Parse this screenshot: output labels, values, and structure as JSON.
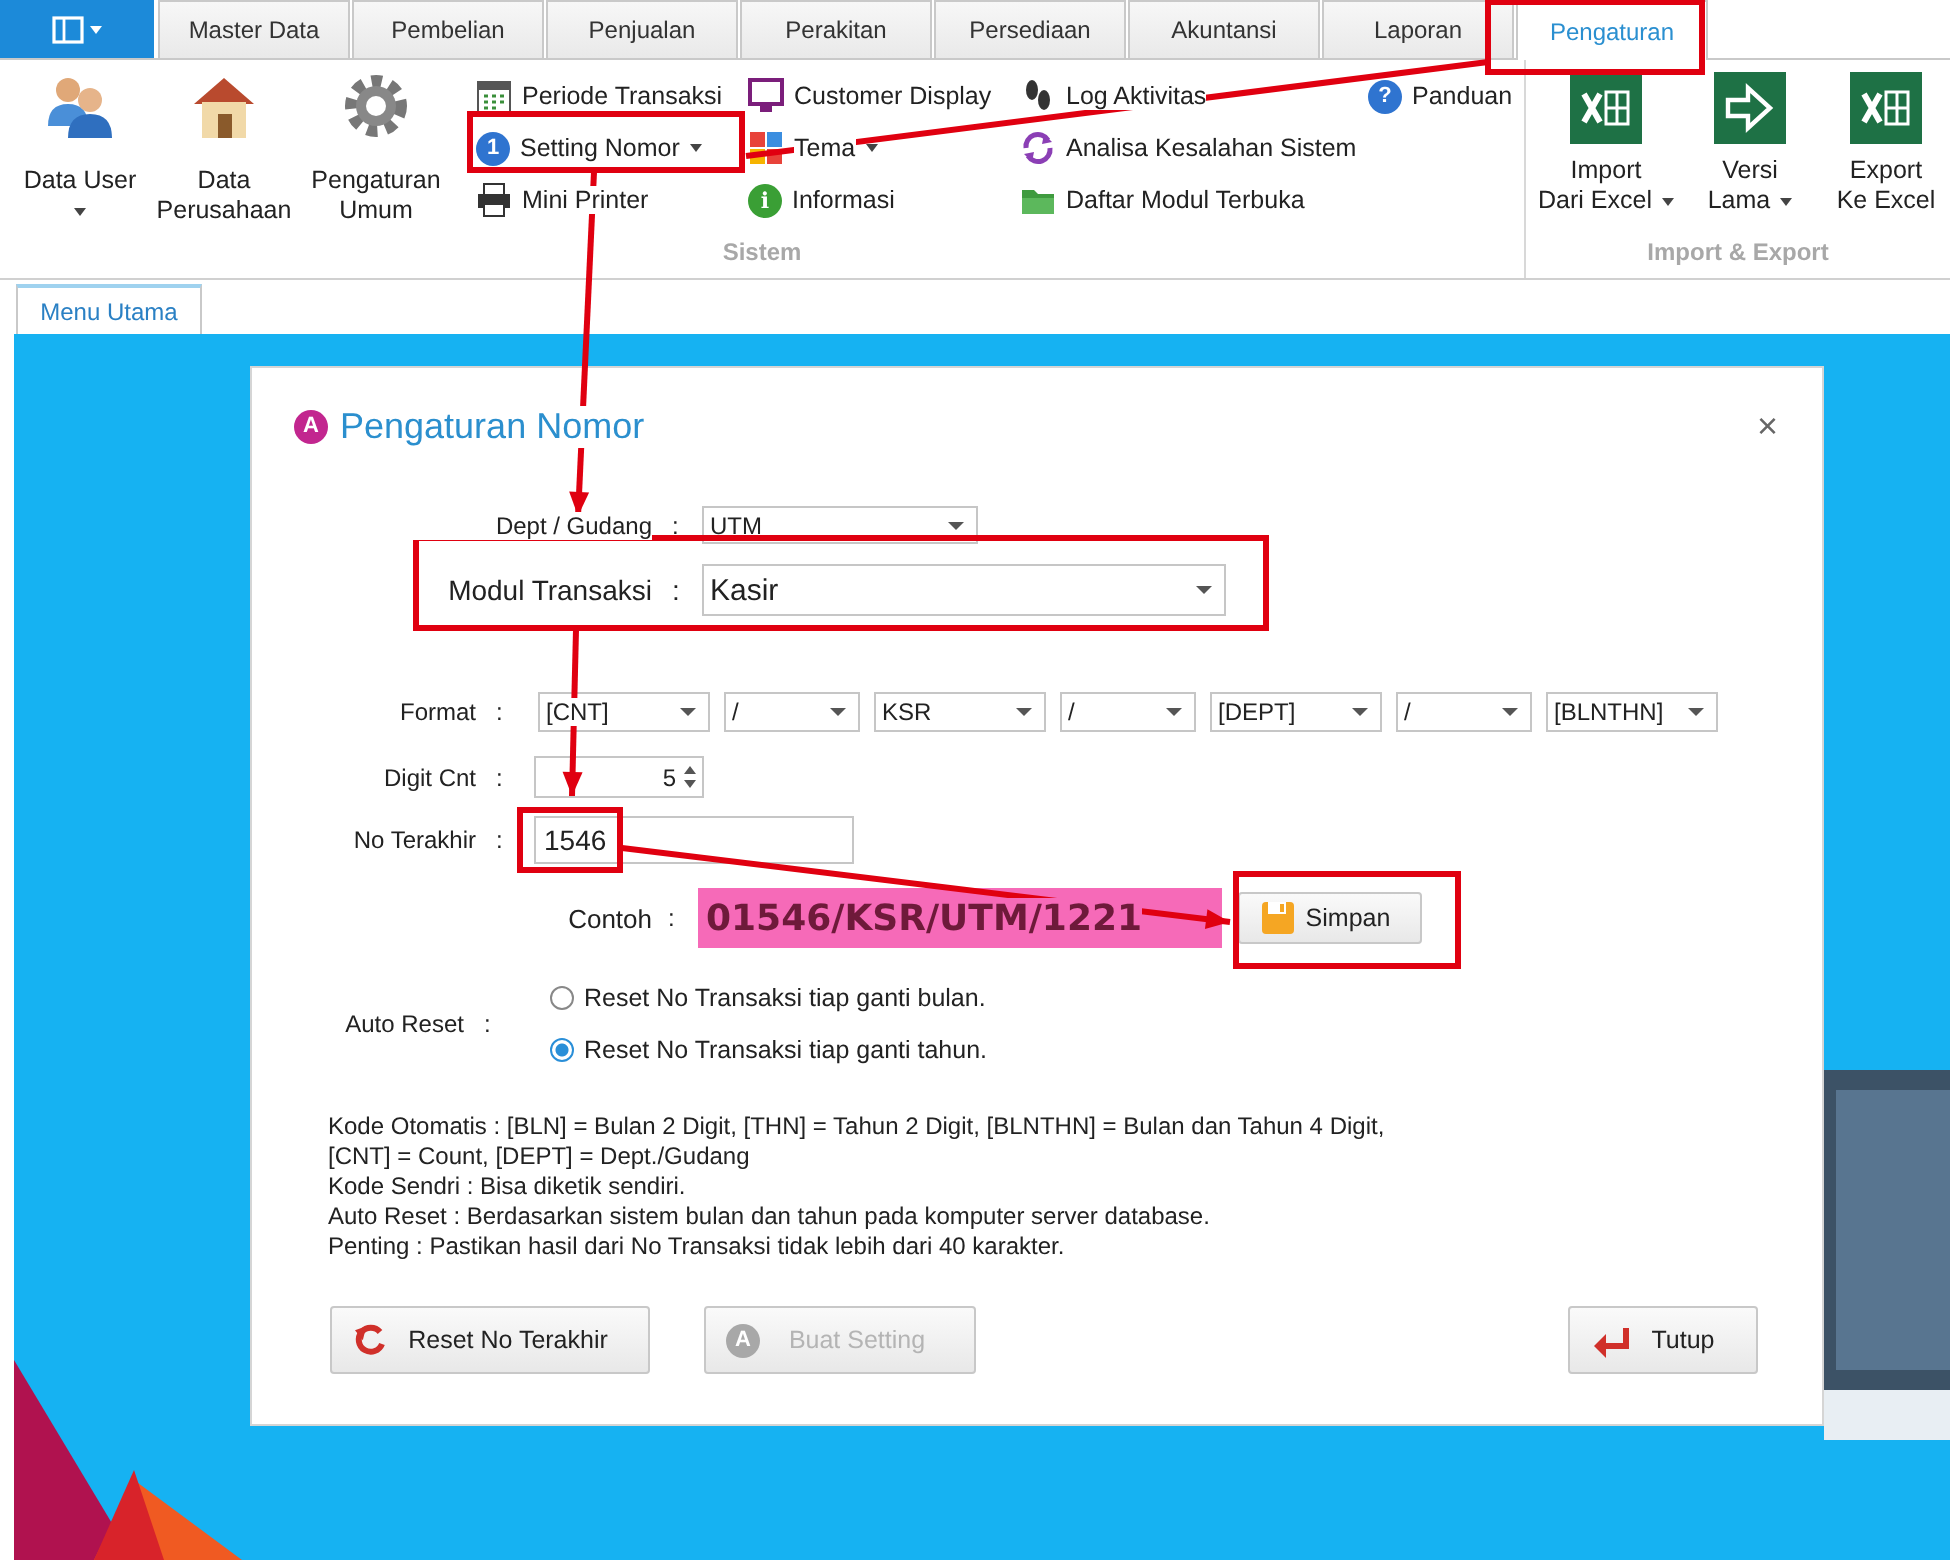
{
  "tabs": [
    {
      "label": "Master Data",
      "selected": false
    },
    {
      "label": "Pembelian",
      "selected": false
    },
    {
      "label": "Penjualan",
      "selected": false
    },
    {
      "label": "Perakitan",
      "selected": false
    },
    {
      "label": "Persediaan",
      "selected": false
    },
    {
      "label": "Akuntansi",
      "selected": false
    },
    {
      "label": "Laporan",
      "selected": false
    },
    {
      "label": "Pengaturan",
      "selected": true
    }
  ],
  "ribbon": {
    "groups": [
      {
        "label": "Sistem",
        "large_buttons": [
          {
            "lines": [
              "Data User"
            ],
            "dropdown": true,
            "kind": "users"
          },
          {
            "lines": [
              "Data",
              "Perusahaan"
            ],
            "dropdown": false,
            "kind": "house"
          },
          {
            "lines": [
              "Pengaturan",
              "Umum"
            ],
            "dropdown": false,
            "kind": "gear"
          }
        ],
        "columns": [
          [
            {
              "label": "Periode Transaksi",
              "kind": "calendar",
              "dropdown": false
            },
            {
              "label": "Setting Nomor",
              "kind": "badge",
              "badge": "1",
              "dropdown": true
            },
            {
              "label": "Mini Printer",
              "kind": "printer",
              "dropdown": false
            }
          ],
          [
            {
              "label": "Customer Display",
              "kind": "monitor",
              "dropdown": false
            },
            {
              "label": "Tema",
              "kind": "tiles",
              "dropdown": true
            },
            {
              "label": "Informasi",
              "kind": "info",
              "badge": "i",
              "dropdown": false
            }
          ],
          [
            {
              "label": "Log Aktivitas",
              "kind": "footprints",
              "dropdown": false
            },
            {
              "label": "Analisa Kesalahan Sistem",
              "kind": "cycle",
              "dropdown": false
            },
            {
              "label": "Daftar Modul Terbuka",
              "kind": "folder",
              "dropdown": false
            }
          ],
          [
            {
              "label": "Panduan",
              "kind": "help",
              "badge": "?",
              "dropdown": false
            }
          ]
        ]
      },
      {
        "label": "Import & Export",
        "large_buttons": [
          {
            "lines": [
              "Import",
              "Dari Excel"
            ],
            "dropdown": true,
            "kind": "excel"
          },
          {
            "lines": [
              "Versi",
              "Lama"
            ],
            "dropdown": true,
            "kind": "enter"
          },
          {
            "lines": [
              "Export",
              "Ke Excel"
            ],
            "dropdown": false,
            "kind": "excel"
          }
        ]
      }
    ]
  },
  "document_tabs": [
    {
      "label": "Menu Utama",
      "selected": true
    }
  ],
  "dialog": {
    "badge": "A",
    "title": "Pengaturan Nomor",
    "close": "×",
    "dept": {
      "label": "Dept / Gudang",
      "colon": ":",
      "value": "UTM"
    },
    "module": {
      "label": "Modul Transaksi",
      "colon": ":",
      "value": "Kasir"
    },
    "format": {
      "label": "Format",
      "colon": ":",
      "parts": [
        "[CNT]",
        "/",
        "KSR",
        "/",
        "[DEPT]",
        "/",
        "[BLNTHN]"
      ]
    },
    "digit_cnt": {
      "label": "Digit Cnt",
      "colon": ":",
      "value": "5"
    },
    "last_number": {
      "label": "No Terakhir",
      "colon": ":",
      "value": "1546"
    },
    "example": {
      "label": "Contoh",
      "colon": ":",
      "value": "01546/KSR/UTM/1221"
    },
    "save_button": "Simpan",
    "auto_reset": {
      "label": "Auto Reset",
      "colon": ":",
      "options": [
        {
          "label": "Reset No Transaksi tiap ganti bulan.",
          "selected": false
        },
        {
          "label": "Reset No Transaksi tiap ganti tahun.",
          "selected": true
        }
      ]
    },
    "notes": [
      "Kode Otomatis : [BLN] = Bulan 2 Digit, [THN] = Tahun 2 Digit, [BLNTHN] = Bulan dan Tahun 4 Digit,",
      "[CNT] = Count, [DEPT] = Dept./Gudang",
      "Kode Sendri : Bisa diketik sendiri.",
      "Auto Reset : Berdasarkan sistem bulan dan tahun pada komputer server database.",
      "Penting : Pastikan hasil dari No Transaksi tidak lebih dari 40 karakter."
    ],
    "buttons": [
      {
        "label": "Reset No Terakhir",
        "kind": "reset",
        "disabled": false
      },
      {
        "label": "Buat Setting",
        "kind": "badge",
        "badge": "A",
        "disabled": true
      },
      {
        "label": "Tutup",
        "kind": "exit",
        "disabled": false
      }
    ]
  }
}
